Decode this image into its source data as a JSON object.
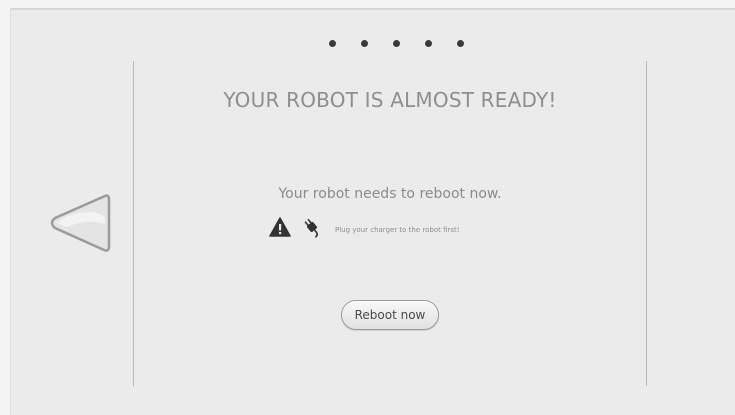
{
  "pager": {
    "dot_count": 5
  },
  "main": {
    "title": "YOUR ROBOT IS ALMOST READY!",
    "message": "Your robot needs to reboot now.",
    "hint": "Plug your charger to the robot first!",
    "reboot_label": "Reboot now"
  },
  "icons": {
    "back": "back-arrow-icon",
    "warning": "warning-icon",
    "plug": "plug-icon"
  },
  "colors": {
    "background": "#ebebeb",
    "text": "#8e8e8e",
    "dots": "#3a3a3a"
  }
}
